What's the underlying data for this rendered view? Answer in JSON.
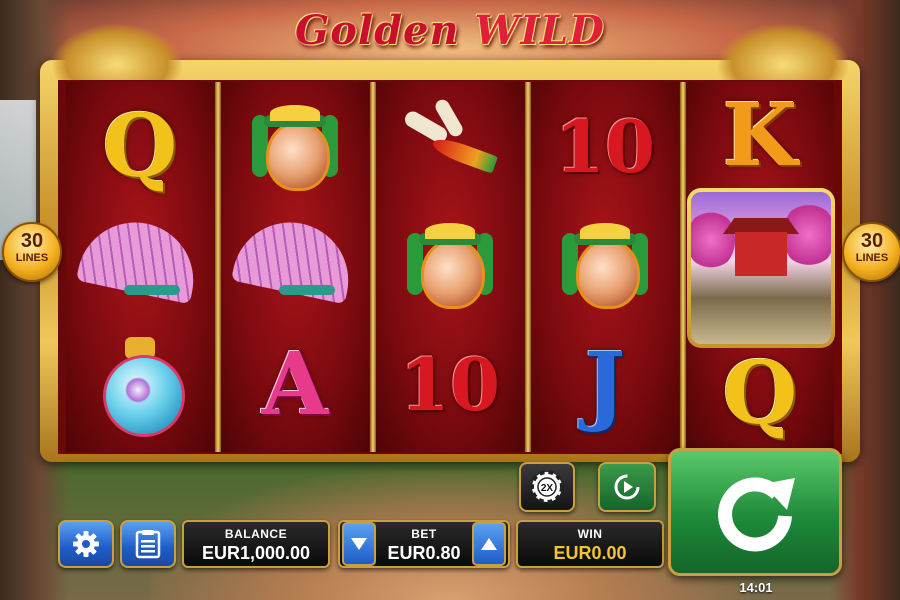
{
  "game": {
    "title_part1": "Golden",
    "title_part2": "WILD"
  },
  "lines_badge": {
    "count": "30",
    "label": "LINES"
  },
  "reels": [
    [
      "Q",
      "pot",
      "fan",
      "vase"
    ],
    [
      "pot",
      "fan",
      "A"
    ],
    [
      "scroll",
      "pot",
      "10"
    ],
    [
      "10",
      "pot",
      "J"
    ],
    [
      "K",
      "wild",
      "Q"
    ]
  ],
  "symbols": {
    "q_letter": "Q",
    "k_letter": "K",
    "a_letter": "A",
    "j_letter": "J",
    "ten_label": "10"
  },
  "controls": {
    "settings_icon": "gear-icon",
    "paytable_icon": "list-icon",
    "gamble_icon": "chip-2x-icon",
    "chip_label": "2X",
    "autoplay_icon": "replay-icon",
    "spin_icon": "spin-arrow-icon",
    "bet_down_icon": "triangle-down-icon",
    "bet_up_icon": "triangle-up-icon"
  },
  "balance": {
    "label": "BALANCE",
    "value": "EUR1,000.00"
  },
  "bet": {
    "label": "BET",
    "value": "EUR0.80"
  },
  "win": {
    "label": "WIN",
    "value": "EUR0.00"
  },
  "clock": "14:01",
  "colors": {
    "frame_gold": "#c9a040",
    "reel_red": "#7a0a0e",
    "spin_green": "#1e8a3a",
    "button_blue": "#1e5cc8",
    "win_text": "#f4c430"
  }
}
